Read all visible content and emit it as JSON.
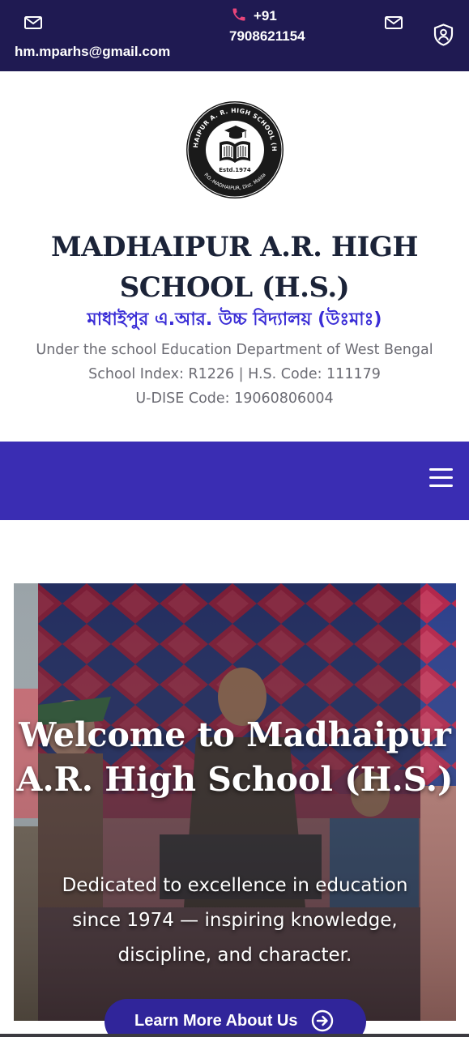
{
  "topbar": {
    "email": "hm.mparhs@gmail.com",
    "phone": "+91 7908621154",
    "icons": [
      "mail-icon",
      "phone-icon",
      "mail-icon",
      "user-shield-icon"
    ]
  },
  "header": {
    "logo": {
      "ring_text": "MADHAIPUR A. R. HIGH SCHOOL (H.S.)",
      "bottom_text": "P.O.-MADHAIPUR, Dist. Malda",
      "estd": "Estd.1974"
    },
    "school_name": "MADHAIPUR A.R. HIGH SCHOOL (H.S.)",
    "bengali_name": "মাধাইপুর এ.আর. উচ্চ বিদ্যালয় (উঃমাঃ)",
    "info_line1": "Under the school Education Department of West Bengal",
    "info_line2": "School Index: R1226 | H.S. Code: 111179",
    "info_line3": "U-DISE Code: 19060806004"
  },
  "navbar": {
    "menu_icon": "hamburger-menu-icon"
  },
  "hero": {
    "title": "Welcome to Madhaipur A.R. High School (H.S.)",
    "subtitle": "Dedicated to excellence in education since 1974 — inspiring knowledge, discipline, and character.",
    "cta_label": "Learn More About Us",
    "cta_icon": "arrow-circle-right-icon"
  },
  "colors": {
    "topbar": "#1f1a52",
    "navbar": "#3a2db3",
    "bengali_text": "#3a2dd6",
    "cta": "#30259a"
  }
}
